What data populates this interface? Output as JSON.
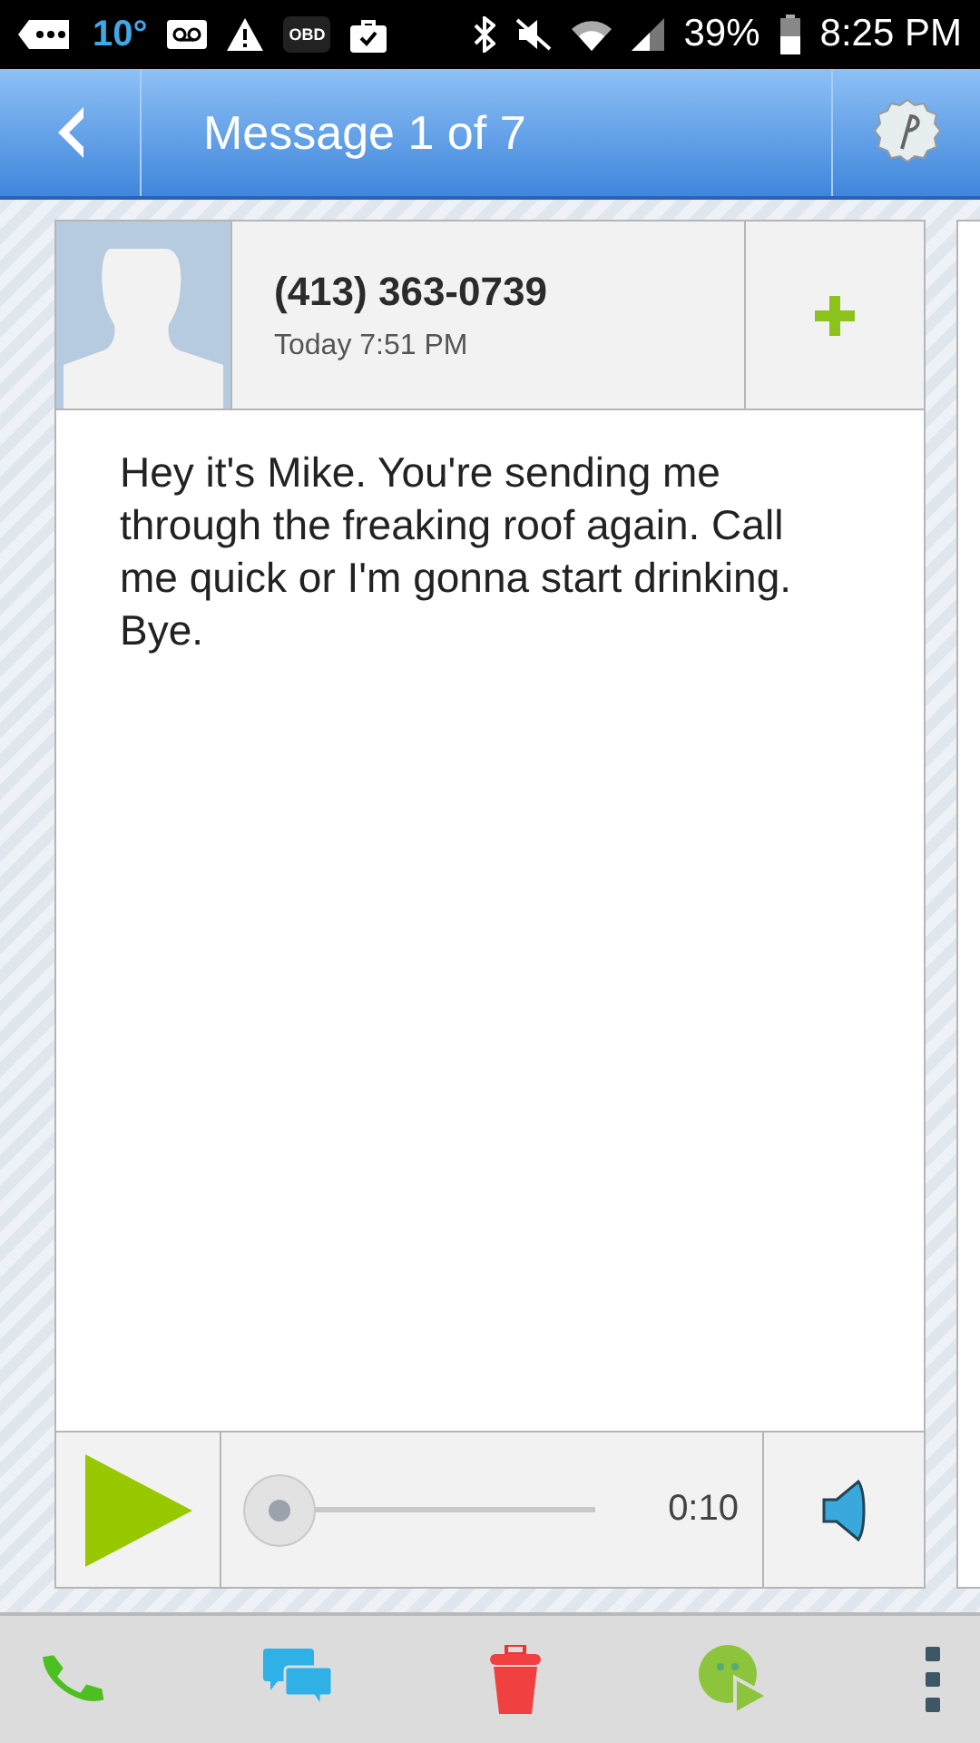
{
  "status_bar": {
    "temperature": "10°",
    "obd_label": "OBD",
    "battery": "39%",
    "time": "8:25 PM"
  },
  "header": {
    "title": "Message 1 of 7"
  },
  "message": {
    "phone": "(413) 363-0739",
    "time": "Today 7:51 PM",
    "transcript": "Hey it's Mike. You're sending me through the freaking roof again. Call me quick or I'm gonna start drinking. Bye."
  },
  "player": {
    "level": 0,
    "duration": "0:10"
  }
}
